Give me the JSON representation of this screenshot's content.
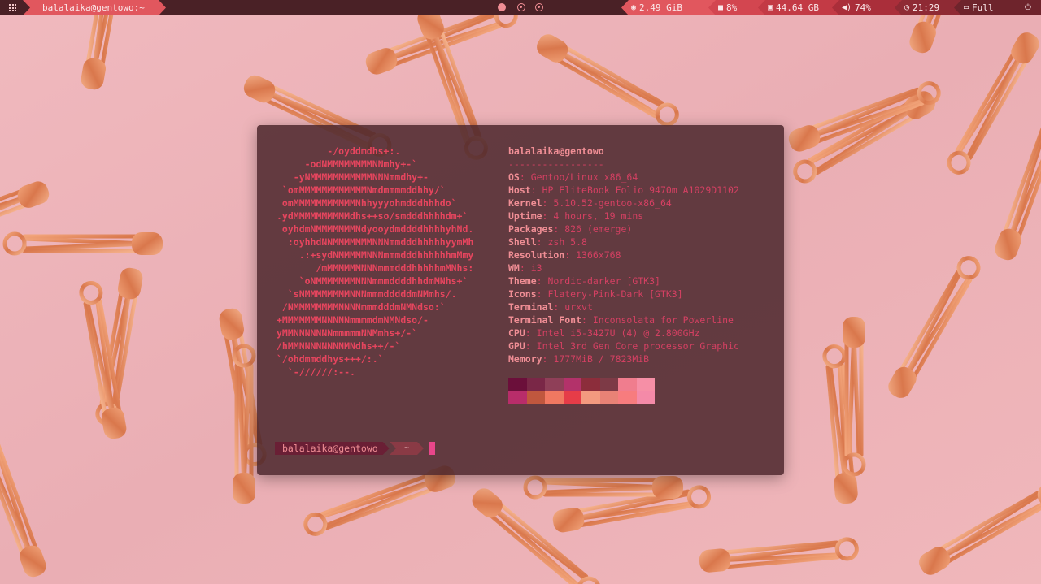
{
  "topbar": {
    "apps_icon": "grid-icon",
    "hostname": "balalaika@gentowo:~",
    "workspaces": [
      {
        "name": "workspace-1",
        "icon": "filled-circle-icon",
        "active": true
      },
      {
        "name": "workspace-2",
        "icon": "ring-dot-icon",
        "active": false
      },
      {
        "name": "workspace-3",
        "icon": "ring-dot-icon",
        "active": false
      }
    ],
    "memory": {
      "icon": "memory-icon",
      "value": "2.49 GiB"
    },
    "cpu": {
      "icon": "cpu-icon",
      "value": "8%"
    },
    "disk": {
      "icon": "disk-icon",
      "value": "44.64 GB"
    },
    "volume": {
      "icon": "volume-icon",
      "value": "74%"
    },
    "clock": {
      "icon": "clock-icon",
      "value": "21:29"
    },
    "battery": {
      "icon": "battery-icon",
      "value": "Full"
    },
    "power_icon": "power-icon",
    "colors": {
      "bar": "#4a2126",
      "accent": "#e1575e"
    }
  },
  "terminal": {
    "logo": [
      "         -/oyddmdhs+:.",
      "     -odNMMMMMMMMNNmhy+-`",
      "   -yNMMMMMMMMMMMNNNmmdhy+-",
      " `omMMMMMMMMMMMMNmdmmmmddhhy/`",
      " omMMMMMMMMMMMNhhyyyohmdddhhhdo`",
      ".ydMMMMMMMMMMdhs++so/smdddhhhhdm+`",
      " oyhdmNMMMMMMMNdyooydmddddhhhhyhNd.",
      "  :oyhhdNNMMMMMMMNNNmmdddhhhhhyymMh",
      "    .:+sydNMMMMMNNNmmmdddhhhhhhmMmy",
      "       /mMMMMMMNNNmmmdddhhhhhmMNhs:",
      "    `oNMMMMMMMNNNmmmddddhhdmMNhs+`",
      "  `sNMMMMMMMMNNNmmmdddddmNMmhs/.",
      " /NMMMMMMMMNNNNmmmdddmNMNdso:`",
      "+MMMMMMMNNNNNmmmmdmNMNdso/-",
      "yMMNNNNNNNmmmmmNNMmhs+/-`",
      "/hMMNNNNNNNNMNdhs++/-`",
      "`/ohdmmddhys+++/:.`",
      "  `-//////:--."
    ],
    "header": "balalaika@gentowo",
    "separator": "-----------------",
    "info": [
      {
        "key": "OS",
        "value": "Gentoo/Linux x86_64"
      },
      {
        "key": "Host",
        "value": "HP EliteBook Folio 9470m A1029D1102"
      },
      {
        "key": "Kernel",
        "value": "5.10.52-gentoo-x86_64"
      },
      {
        "key": "Uptime",
        "value": "4 hours, 19 mins"
      },
      {
        "key": "Packages",
        "value": "826 (emerge)"
      },
      {
        "key": "Shell",
        "value": "zsh 5.8"
      },
      {
        "key": "Resolution",
        "value": "1366x768"
      },
      {
        "key": "WM",
        "value": "i3"
      },
      {
        "key": "Theme",
        "value": "Nordic-darker [GTK3]"
      },
      {
        "key": "Icons",
        "value": "Flatery-Pink-Dark [GTK3]"
      },
      {
        "key": "Terminal",
        "value": "urxvt"
      },
      {
        "key": "Terminal Font",
        "value": "Inconsolata for Powerline"
      },
      {
        "key": "CPU",
        "value": "Intel i5-3427U (4) @ 2.800GHz"
      },
      {
        "key": "GPU",
        "value": "Intel 3rd Gen Core processor Graphic"
      },
      {
        "key": "Memory",
        "value": "1777MiB / 7823MiB"
      }
    ],
    "palette": [
      [
        "#6b0f3a",
        "#7a2747",
        "#8f3f58",
        "#b3326a",
        "#8c2d3b",
        "#7d3a46",
        "#f07d8e",
        "#f68fa6"
      ],
      [
        "#b82d6a",
        "#c0573e",
        "#f07861",
        "#e63c48",
        "#f39a7f",
        "#e88276",
        "#f77c7e",
        "#f48aa8"
      ]
    ],
    "prompt": {
      "user": "balalaika@gentowo",
      "dir": "~"
    }
  }
}
